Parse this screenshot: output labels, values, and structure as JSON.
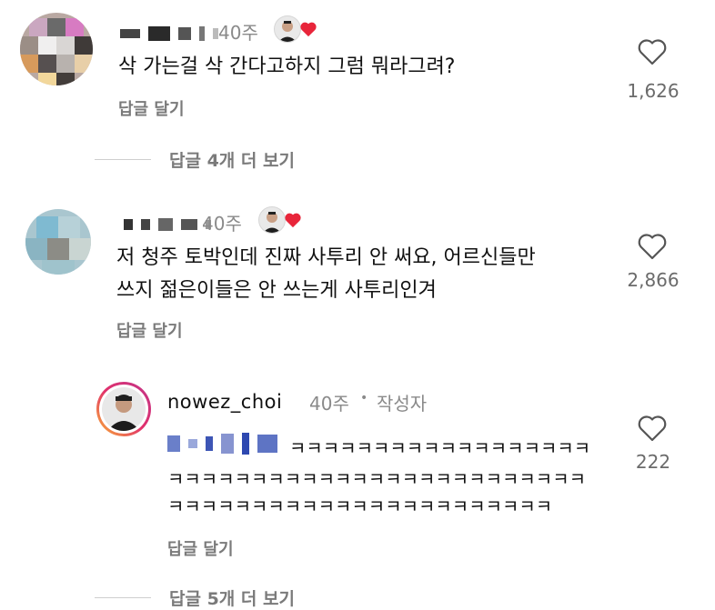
{
  "comments": [
    {
      "username": "",
      "time": "40주",
      "text": "삭 가는걸 삭 간다고하지 그럼 뭐라그려?",
      "reply_label": "답글 달기",
      "likes": "1,626"
    },
    {
      "username": "",
      "time": "40주",
      "text_line1": "저 청주 토박인데 진짜 사투리 안 써요, 어르신들만",
      "text_line2": "쓰지 젊은이들은 안 쓰는게 사투리인겨",
      "reply_label": "답글 달기",
      "likes": "2,866"
    }
  ],
  "author_reply": {
    "username": "nowez_choi",
    "time": "40주",
    "dot": "•",
    "author_badge": "작성자",
    "line1": "ㅋㅋㅋㅋㅋㅋㅋㅋㅋㅋㅋㅋㅋㅋㅋㅋㅋㅋ",
    "line2": "ㅋㅋㅋㅋㅋㅋㅋㅋㅋㅋㅋㅋㅋㅋㅋㅋㅋㅋㅋㅋㅋㅋㅋㅋㅋ",
    "line3": "ㅋㅋㅋㅋㅋㅋㅋㅋㅋㅋㅋㅋㅋㅋㅋㅋㅋㅋㅋㅋㅋㅋㅋ",
    "reply_label": "답글 달기",
    "likes": "222"
  },
  "view_replies": [
    {
      "label": "답글 4개 더 보기"
    },
    {
      "label": "답글 5개 더 보기"
    }
  ],
  "icons": {
    "heart": "heart-outline-icon",
    "liked": "red-heart-icon"
  },
  "colors": {
    "liked_heart": "#e8253a",
    "story_ring_start": "#f9b233",
    "story_ring_end": "#c1358a"
  }
}
